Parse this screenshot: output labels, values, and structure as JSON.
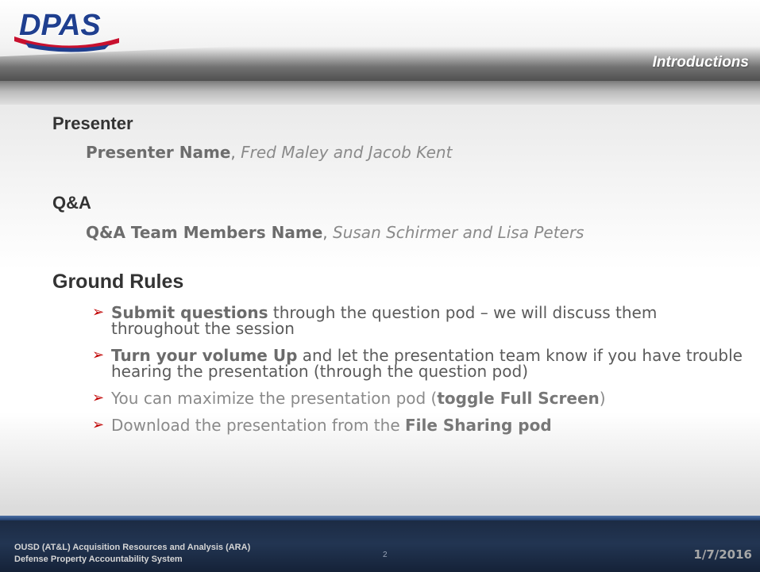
{
  "header": {
    "logo_text": "DPAS",
    "title": "Introductions"
  },
  "sections": {
    "presenter": {
      "heading": "Presenter",
      "role": "Presenter Name",
      "separator": ", ",
      "names": "Fred Maley and Jacob Kent"
    },
    "qa": {
      "heading": "Q&A",
      "role": "Q&A Team Members Name",
      "separator": ", ",
      "names": "Susan Schirmer and Lisa Peters"
    },
    "ground_rules": {
      "heading": "Ground Rules",
      "bullet_glyph": "➢",
      "items": [
        {
          "bold": "Submit questions",
          "rest": " through the question pod – we will discuss them throughout the session"
        },
        {
          "bold": "Turn your volume Up",
          "rest": " and let the presentation team know if you have trouble hearing the presentation (through the question pod)"
        },
        {
          "pre": "You can maximize the presentation pod (",
          "bold": "toggle Full Screen",
          "post": ")"
        },
        {
          "pre": "Download the presentation from the ",
          "bold": "File Sharing pod"
        }
      ]
    }
  },
  "footer": {
    "org_line1": "OUSD (AT&L) Acquisition Resources and Analysis (ARA)",
    "org_line2": "Defense Property Accountability System",
    "page_number": "2",
    "date": "1/7/2016"
  },
  "colors": {
    "accent_red": "#c00000",
    "logo_red": "#c8102e",
    "logo_blue": "#1f3f8f",
    "footer_navy": "#1c2b44"
  }
}
